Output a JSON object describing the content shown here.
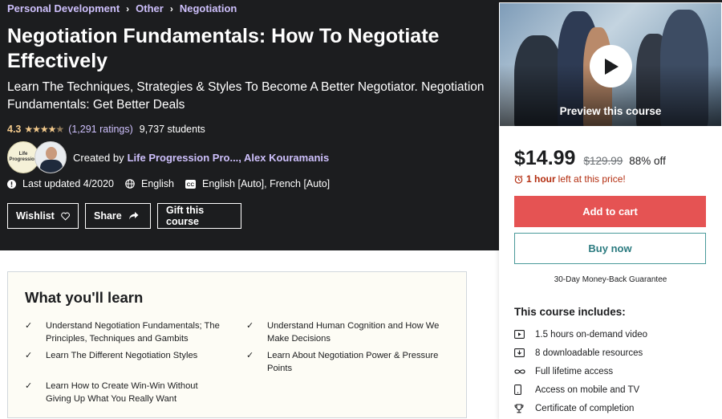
{
  "breadcrumbs": [
    "Personal Development",
    "Other",
    "Negotiation"
  ],
  "course": {
    "title": "Negotiation Fundamentals: How To Negotiate Effectively",
    "subtitle": "Learn The Techniques, Strategies & Styles To Become A Better Negotiator. Negotiation Fundamentals: Get Better Deals",
    "rating": "4.3",
    "ratings_count": "(1,291 ratings)",
    "students": "9,737 students",
    "created_by_label": "Created by",
    "instructors": "Life Progression Pro..., Alex Kouramanis",
    "avatar1_text": "Life Progression",
    "last_updated": "Last updated 4/2020",
    "language": "English",
    "captions": "English [Auto], French [Auto]"
  },
  "actions": {
    "wishlist": "Wishlist",
    "share": "Share",
    "gift": "Gift this course"
  },
  "sidebar": {
    "preview_label": "Preview this course",
    "price": "$14.99",
    "original_price": "$129.99",
    "discount": "88% off",
    "timer_bold": "1 hour",
    "timer_rest": "left at this price!",
    "add_to_cart": "Add to cart",
    "buy_now": "Buy now",
    "guarantee": "30-Day Money-Back Guarantee",
    "includes_title": "This course includes:",
    "includes": [
      {
        "icon": "video-icon",
        "text": "1.5 hours on-demand video"
      },
      {
        "icon": "file-icon",
        "text": "8 downloadable resources"
      },
      {
        "icon": "infinity-icon",
        "text": "Full lifetime access"
      },
      {
        "icon": "mobile-icon",
        "text": "Access on mobile and TV"
      },
      {
        "icon": "trophy-icon",
        "text": "Certificate of completion"
      }
    ]
  },
  "learn": {
    "title": "What you'll learn",
    "items": [
      "Understand Negotiation Fundamentals; The Principles, Techniques and Gambits",
      "Understand Human Cognition and How We Make Decisions",
      "Learn The Different Negotiation Styles",
      "Learn About Negotiation Power & Pressure Points",
      "Learn How to Create Win-Win Without Giving Up What You Really Want"
    ]
  },
  "colors": {
    "hero_bg": "#1c1d1f",
    "link_purple": "#cec0fc",
    "star_gold": "#f3ca8c",
    "cart_red": "#e55353",
    "timer_red": "#b32d0f"
  }
}
